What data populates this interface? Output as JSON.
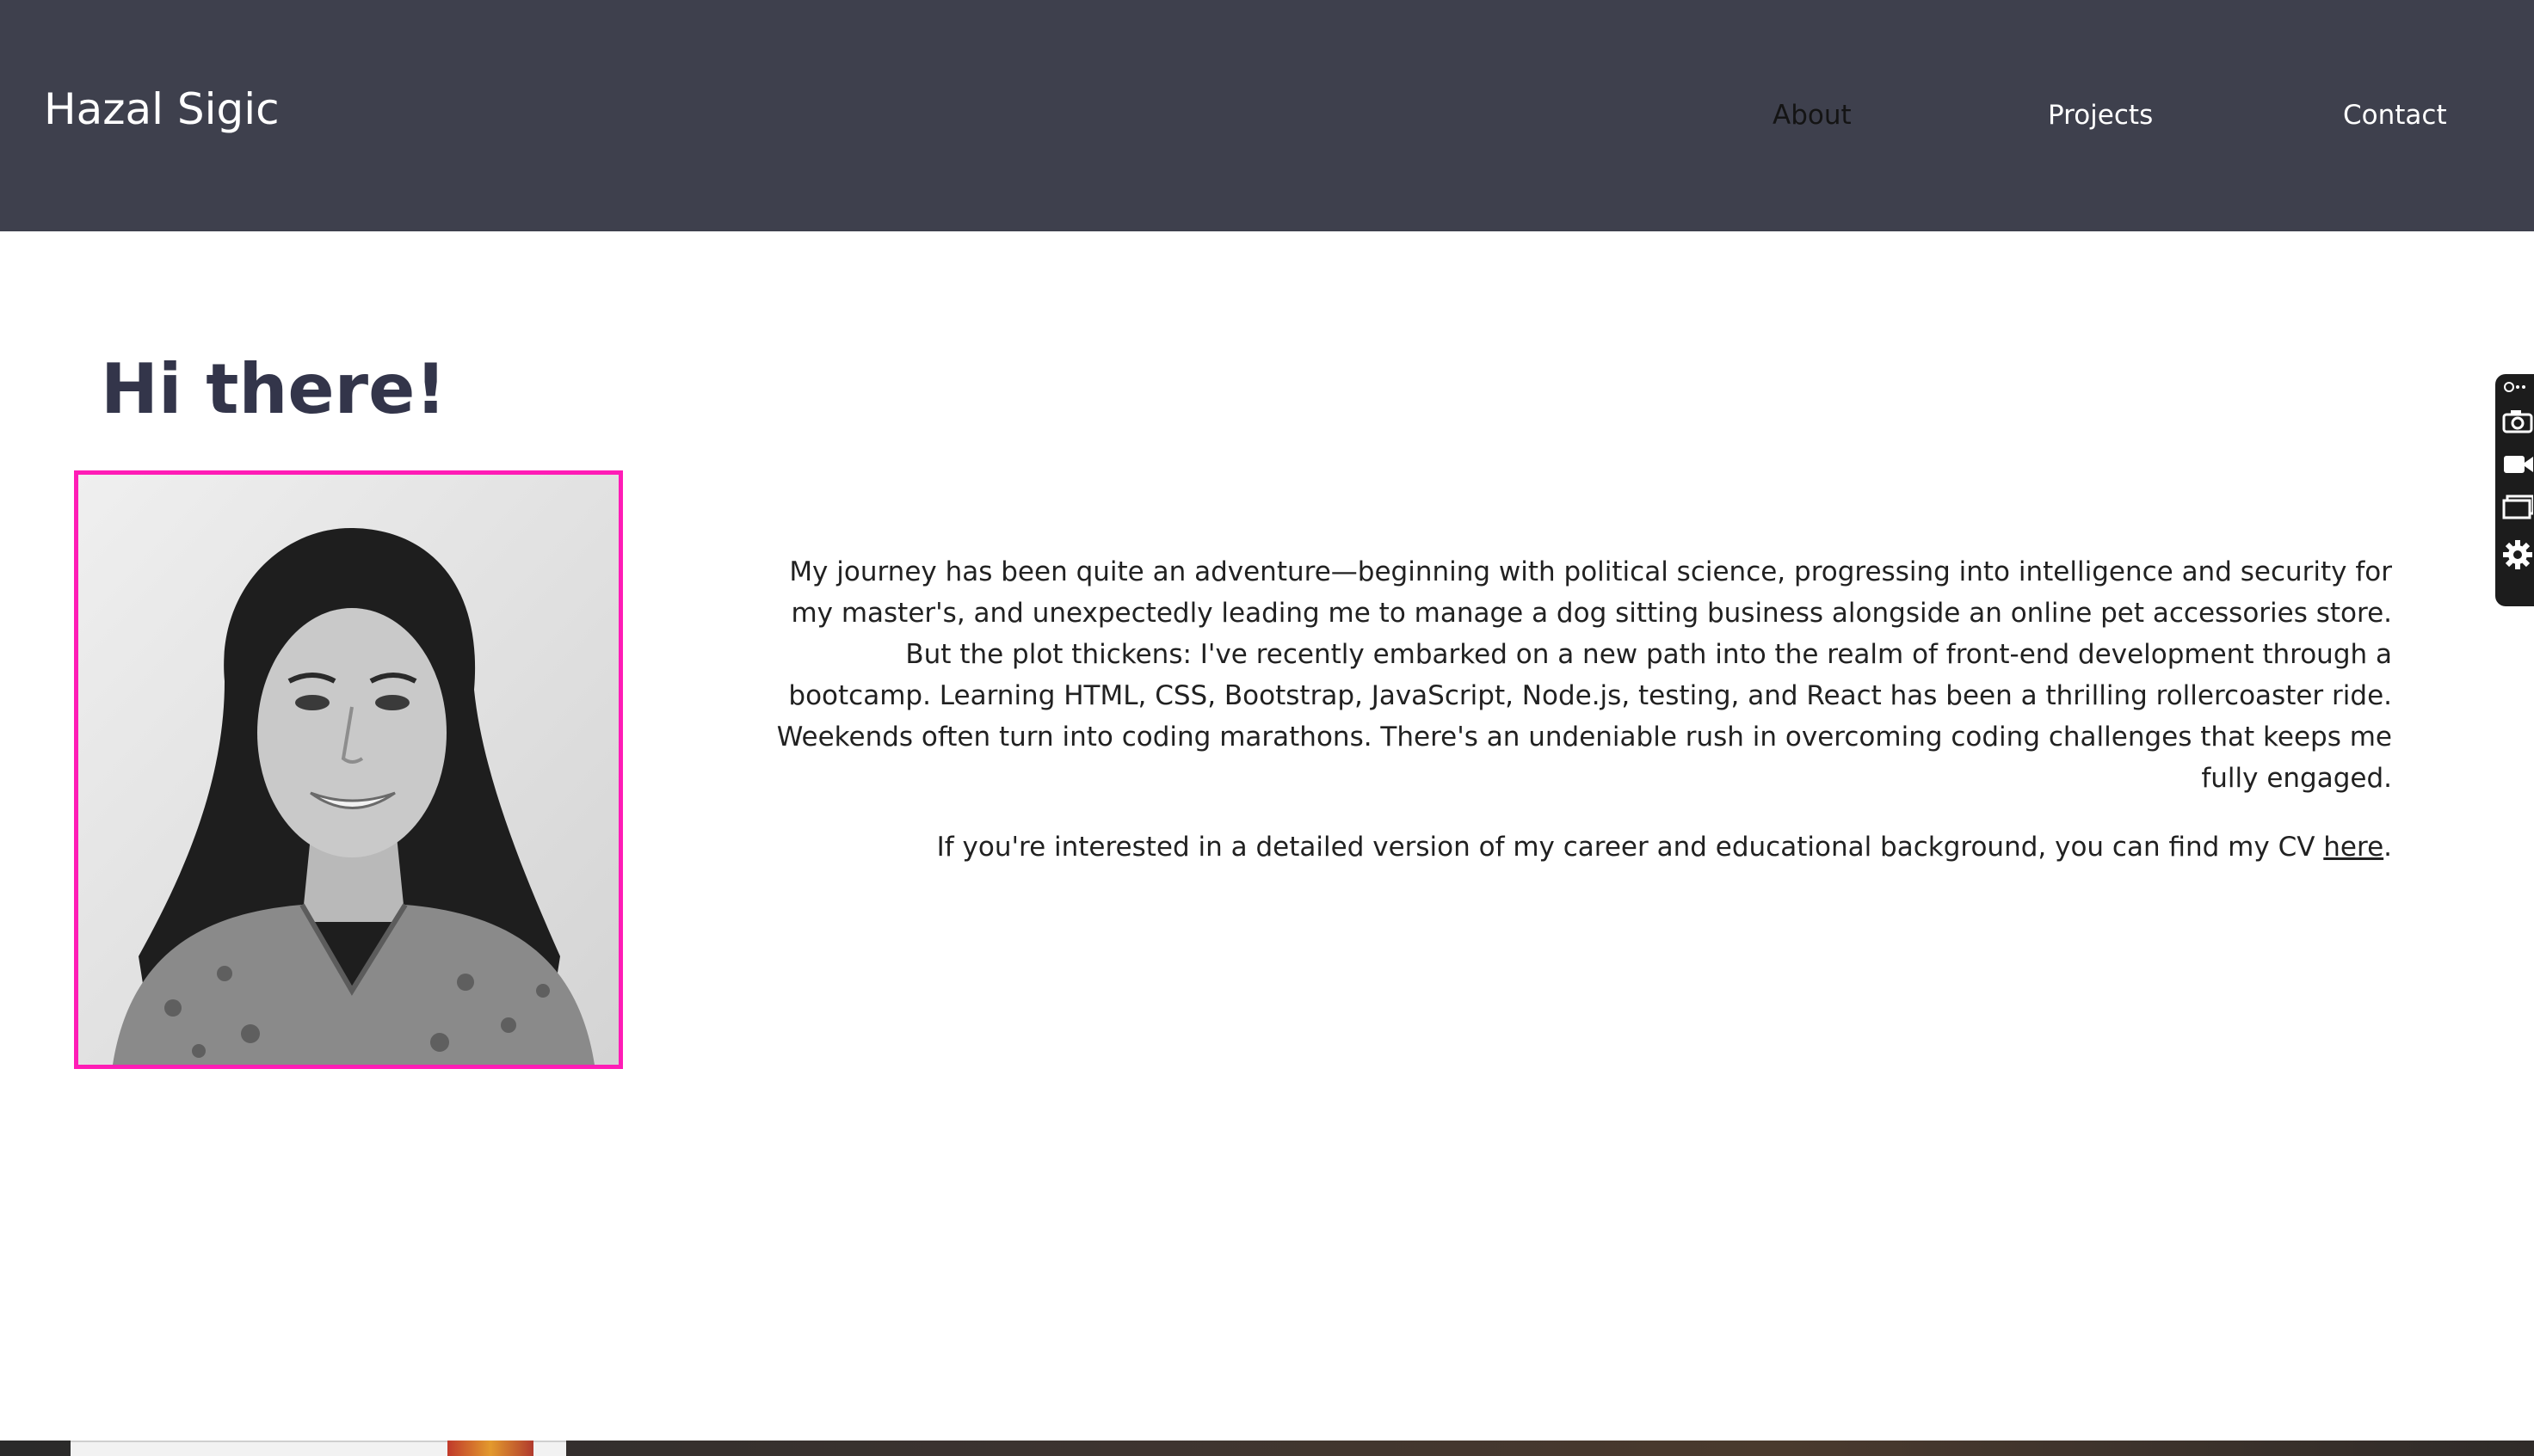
{
  "navbar": {
    "brand": "Hazal Sigic",
    "links": [
      {
        "label": "About",
        "active": true
      },
      {
        "label": "Projects",
        "active": false
      },
      {
        "label": "Contact",
        "active": false
      }
    ]
  },
  "main": {
    "greeting": "Hi there!",
    "bio": "My journey has been quite an adventure—beginning with political science, progressing into intelligence and security for my master's, and unexpectedly leading me to manage a dog sitting business alongside an online pet accessories store. But the plot thickens: I've recently embarked on a new path into the realm of front-end development through a bootcamp. Learning HTML, CSS, Bootstrap, JavaScript, Node.js, testing, and React has been a thrilling rollercoaster ride. Weekends often turn into coding marathons. There's an undeniable rush in overcoming coding challenges that keeps me fully engaged.",
    "cv_prefix": "If you're interested in a detailed version of my career and educational background, you can find my CV ",
    "cv_link": "here",
    "cv_suffix": "."
  },
  "colors": {
    "navbar_bg": "#3e404d",
    "heading": "#33354a",
    "photo_border": "#ff1cb6",
    "active_link": "#141414"
  },
  "side_toolbar": {
    "icons": [
      "link-icon",
      "camera-icon",
      "video-icon",
      "screen-icon",
      "gear-icon"
    ]
  }
}
